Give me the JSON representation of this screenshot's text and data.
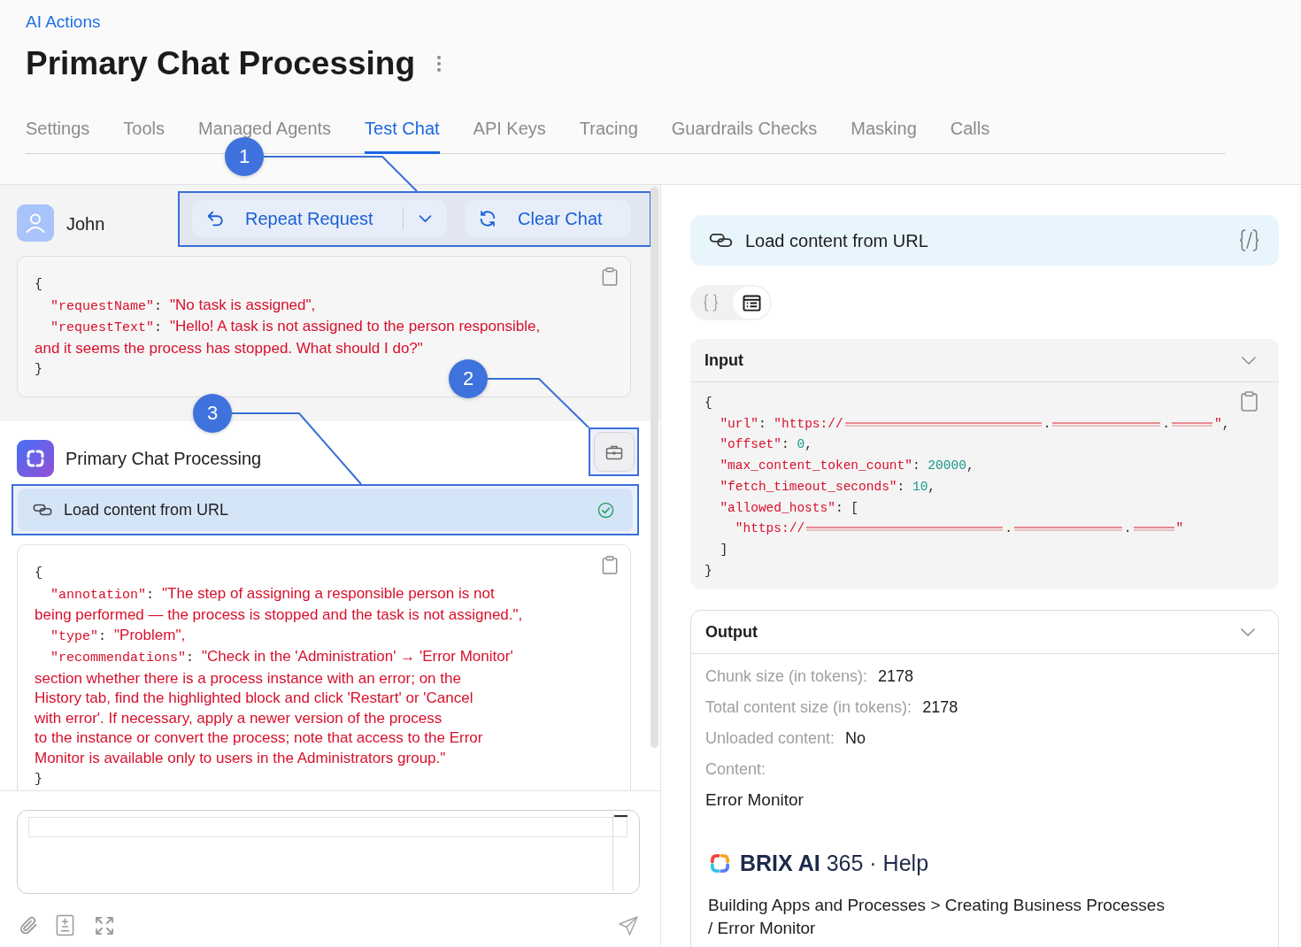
{
  "breadcrumb": {
    "label": "AI Actions"
  },
  "page": {
    "title": "Primary Chat Processing"
  },
  "tabs": [
    {
      "label": "Settings",
      "selected": false
    },
    {
      "label": "Tools",
      "selected": false
    },
    {
      "label": "Managed Agents",
      "selected": false
    },
    {
      "label": "Test Chat",
      "selected": true
    },
    {
      "label": "API Keys",
      "selected": false
    },
    {
      "label": "Tracing",
      "selected": false
    },
    {
      "label": "Guardrails Checks",
      "selected": false
    },
    {
      "label": "Masking",
      "selected": false
    },
    {
      "label": "Calls",
      "selected": false
    }
  ],
  "chat": {
    "user_message": {
      "author": "John",
      "actions": {
        "highlighted": true,
        "buttons": [
          {
            "kind": "split",
            "label": "Repeat Request"
          },
          {
            "kind": "plain",
            "label": "Clear Chat"
          }
        ]
      },
      "code": [
        {
          "segments": [
            {
              "kind": "punct",
              "text": "{"
            }
          ]
        },
        {
          "segments": [
            {
              "kind": "key",
              "text": "  \"requestName\""
            },
            {
              "kind": "punct",
              "text": ": "
            },
            {
              "kind": "text",
              "text": "\"No task is assigned\","
            }
          ]
        },
        {
          "segments": [
            {
              "kind": "key",
              "text": "  \"requestText\""
            },
            {
              "kind": "punct",
              "text": ": "
            },
            {
              "kind": "text",
              "text": "\"Hello! A task is not assigned to the person responsible,\nand it seems the process has stopped. What should I do?\""
            }
          ]
        },
        {
          "segments": [
            {
              "kind": "punct",
              "text": "}"
            }
          ]
        }
      ]
    },
    "agent_message": {
      "author": "Primary Chat Processing",
      "toolbox_button": {
        "highlighted": true
      },
      "tool_call": {
        "label": "Load content from URL",
        "done": true,
        "highlighted": true
      },
      "code": [
        {
          "segments": [
            {
              "kind": "punct",
              "text": "{"
            }
          ]
        },
        {
          "segments": [
            {
              "kind": "key",
              "text": "  \"annotation\""
            },
            {
              "kind": "punct",
              "text": ": "
            },
            {
              "kind": "text",
              "text": "\"The step of assigning a responsible person is not\nbeing performed — the process is stopped and the task is not assigned.\","
            }
          ]
        },
        {
          "segments": [
            {
              "kind": "key",
              "text": "  \"type\""
            },
            {
              "kind": "punct",
              "text": ": "
            },
            {
              "kind": "text",
              "text": "\"Problem\","
            }
          ]
        },
        {
          "segments": [
            {
              "kind": "key",
              "text": "  \"recommendations\""
            },
            {
              "kind": "punct",
              "text": ": "
            },
            {
              "kind": "text",
              "text": "\"Check in the 'Administration' → 'Error Monitor'\nsection whether there is a process instance with an error; on the\nHistory tab, find the highlighted block and click 'Restart' or 'Cancel\nwith error'. If necessary, apply a newer version of the process\nto the instance or convert the process; note that access to the Error\nMonitor is available only to users in the Administrators group.\""
            }
          ]
        },
        {
          "segments": [
            {
              "kind": "punct",
              "text": "}"
            }
          ]
        }
      ]
    }
  },
  "annotations": [
    {
      "label": "1"
    },
    {
      "label": "2"
    },
    {
      "label": "3"
    }
  ],
  "tool_details": {
    "title": "Load content from URL",
    "view_modes": [
      {
        "kind": "json",
        "selected": false
      },
      {
        "kind": "table",
        "selected": true
      }
    ],
    "input": {
      "title": "Input",
      "code": [
        {
          "segments": [
            {
              "kind": "punct",
              "text": "{"
            }
          ]
        },
        {
          "segments": [
            {
              "kind": "key",
              "text": "  \"url\""
            },
            {
              "kind": "punct",
              "text": ": "
            },
            {
              "kind": "string",
              "text": "\"https://"
            },
            {
              "kind": "redacted"
            },
            {
              "kind": "punct",
              "text": "."
            },
            {
              "kind": "redacted"
            },
            {
              "kind": "punct",
              "text": "."
            },
            {
              "kind": "redacted"
            },
            {
              "kind": "string",
              "text": "\""
            },
            {
              "kind": "punct",
              "text": ","
            }
          ]
        },
        {
          "segments": [
            {
              "kind": "key",
              "text": "  \"offset\""
            },
            {
              "kind": "punct",
              "text": ": "
            },
            {
              "kind": "number",
              "text": "0"
            },
            {
              "kind": "punct",
              "text": ","
            }
          ]
        },
        {
          "segments": [
            {
              "kind": "key",
              "text": "  \"max_content_token_count\""
            },
            {
              "kind": "punct",
              "text": ": "
            },
            {
              "kind": "number",
              "text": "20000"
            },
            {
              "kind": "punct",
              "text": ","
            }
          ]
        },
        {
          "segments": [
            {
              "kind": "key",
              "text": "  \"fetch_timeout_seconds\""
            },
            {
              "kind": "punct",
              "text": ": "
            },
            {
              "kind": "number",
              "text": "10"
            },
            {
              "kind": "punct",
              "text": ","
            }
          ]
        },
        {
          "segments": [
            {
              "kind": "key",
              "text": "  \"allowed_hosts\""
            },
            {
              "kind": "punct",
              "text": ": ["
            }
          ]
        },
        {
          "segments": [
            {
              "kind": "string",
              "text": "    \"https://"
            },
            {
              "kind": "redacted"
            },
            {
              "kind": "punct",
              "text": "."
            },
            {
              "kind": "redacted"
            },
            {
              "kind": "punct",
              "text": "."
            },
            {
              "kind": "redacted"
            },
            {
              "kind": "string",
              "text": "\""
            }
          ]
        },
        {
          "segments": [
            {
              "kind": "punct",
              "text": "  ]"
            }
          ]
        },
        {
          "segments": [
            {
              "kind": "punct",
              "text": "}"
            }
          ]
        }
      ]
    },
    "output": {
      "title": "Output",
      "fields": [
        {
          "label": "Chunk size (in tokens):",
          "value": "2178"
        },
        {
          "label": "Total content size (in tokens):",
          "value": "2178"
        },
        {
          "label": "Unloaded content:",
          "value": "No"
        },
        {
          "label": "Content:"
        }
      ],
      "content": {
        "heading": "Error Monitor",
        "source": "**BRIX AI** 365 · Help",
        "breadcrumb": "Building Apps and Processes > Creating Business Processes\n/ Error Monitor"
      }
    }
  }
}
